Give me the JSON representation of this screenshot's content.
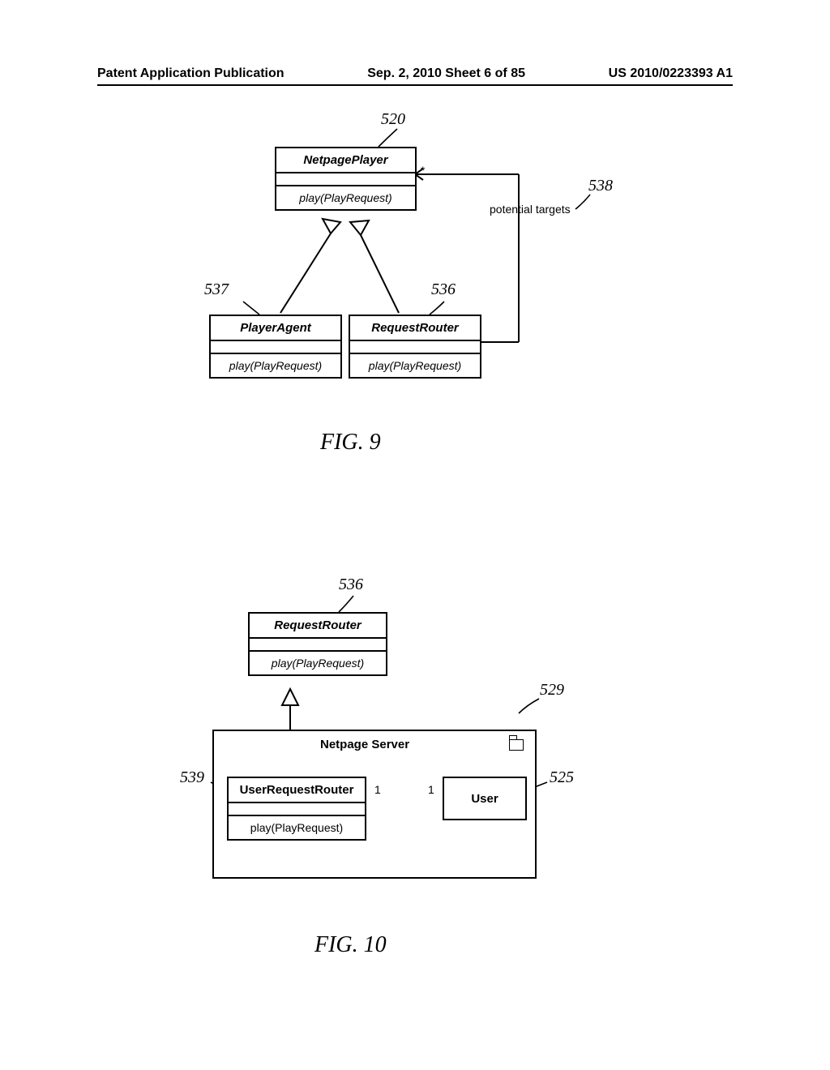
{
  "header": {
    "left": "Patent Application Publication",
    "center": "Sep. 2, 2010  Sheet 6 of 85",
    "right": "US 2010/0223393 A1"
  },
  "fig9": {
    "label": "FIG. 9",
    "ref520": "520",
    "ref537": "537",
    "ref536": "536",
    "ref538": "538",
    "star": "*",
    "potential": "potential targets",
    "netpagePlayer": {
      "name": "NetpagePlayer",
      "method": "play(PlayRequest)"
    },
    "playerAgent": {
      "name": "PlayerAgent",
      "method": "play(PlayRequest)"
    },
    "requestRouter": {
      "name": "RequestRouter",
      "method": "play(PlayRequest)"
    }
  },
  "fig10": {
    "label": "FIG. 10",
    "ref536": "536",
    "ref529": "529",
    "ref539": "539",
    "ref525": "525",
    "serverTitle": "Netpage Server",
    "requestRouter": {
      "name": "RequestRouter",
      "method": "play(PlayRequest)"
    },
    "userRequestRouter": {
      "name": "UserRequestRouter",
      "method": "play(PlayRequest)"
    },
    "user": "User",
    "one_a": "1",
    "one_b": "1"
  }
}
